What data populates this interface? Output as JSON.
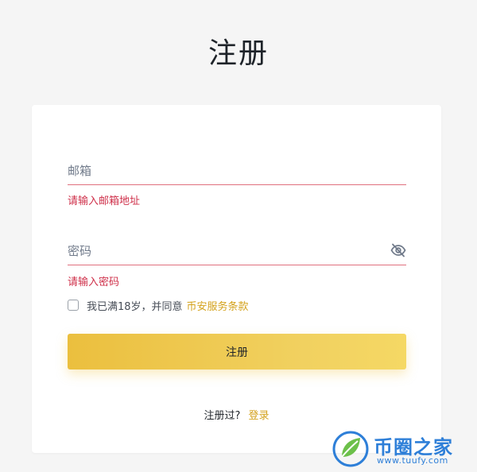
{
  "header": {
    "title": "注册"
  },
  "form": {
    "email": {
      "placeholder": "邮箱",
      "value": "",
      "error": "请输入邮箱地址"
    },
    "password": {
      "placeholder": "密码",
      "value": "",
      "error": "请输入密码",
      "visibility_icon": "eye-off-icon"
    },
    "agreement": {
      "checked": false,
      "text": "我已满18岁，并同意",
      "terms_link": "币安服务条款"
    },
    "submit_label": "注册"
  },
  "footer": {
    "prompt": "注册过?",
    "login_link": "登录"
  },
  "watermark": {
    "title": "币圈之家",
    "url": "www.tuufy.com"
  },
  "colors": {
    "accent": "#f0c040",
    "link": "#d4a21c",
    "error": "#cf304a",
    "watermark": "#2e7fd8"
  }
}
